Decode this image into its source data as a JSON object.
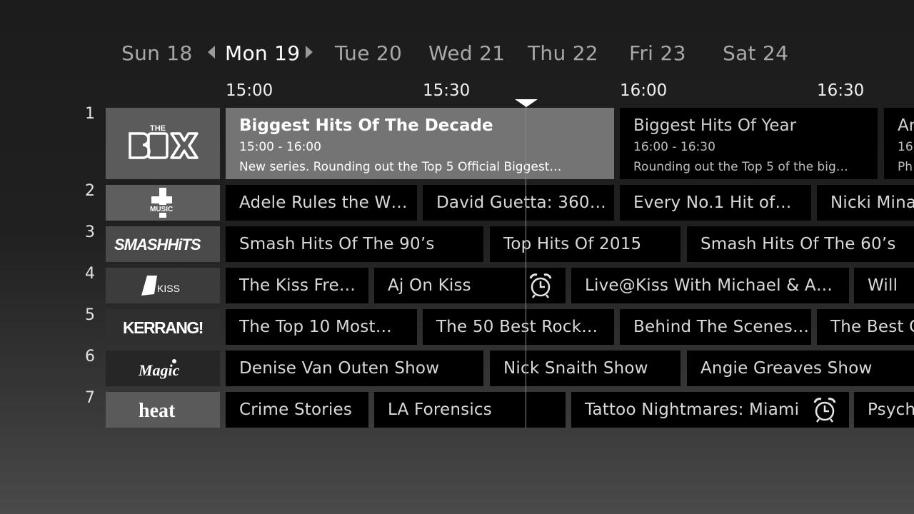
{
  "days": [
    {
      "label": "Sun 18"
    },
    {
      "label": "Mon 19"
    },
    {
      "label": "Tue 20"
    },
    {
      "label": "Wed 21"
    },
    {
      "label": "Thu 22"
    },
    {
      "label": "Fri 23"
    },
    {
      "label": "Sat 24"
    }
  ],
  "selected_day": "Mon 19",
  "times": [
    "15:00",
    "15:30",
    "16:00",
    "16:30"
  ],
  "channels": [
    {
      "number": "1",
      "logo_alt": "THE BOX"
    },
    {
      "number": "2",
      "logo_alt": "4 music"
    },
    {
      "number": "3",
      "logo_alt": "SMASHHITS"
    },
    {
      "number": "4",
      "logo_alt": "KISS"
    },
    {
      "number": "5",
      "logo_alt": "KERRANG!"
    },
    {
      "number": "6",
      "logo_alt": "Magic"
    },
    {
      "number": "7",
      "logo_alt": "heat"
    }
  ],
  "row1": {
    "focused": {
      "title": "Biggest Hits Of The Decade",
      "time": "15:00 - 16:00",
      "desc": "New series. Rounding out the Top 5 Official Biggest…"
    },
    "next": {
      "title": "Biggest Hits Of Year",
      "time": "16:00 - 16:30",
      "desc": "Rounding out the Top 5 of the big…"
    },
    "cut": {
      "title": "Ar",
      "time": "16:",
      "desc": "Ph"
    }
  },
  "row2": [
    "Adele Rules the W…",
    "David Guetta: 360…",
    "Every No.1 Hit of…",
    "Nicki Mina"
  ],
  "row3": [
    "Smash Hits Of The 90’s",
    "Top Hits Of 2015",
    "Smash Hits Of The 60’s"
  ],
  "row4": [
    "The Kiss Fre…",
    "Aj On Kiss",
    "Live@Kiss With Michael & A…",
    "Will"
  ],
  "row5": [
    "The Top 10 Most…",
    "The 50 Best Rock…",
    "Behind The Scenes…",
    "The Best O"
  ],
  "row6": [
    "Denise Van Outen Show",
    "Nick Snaith Show",
    "Angie Greaves Show"
  ],
  "row7": [
    "Crime Stories",
    "LA Forensics",
    "Tattoo Nightmares: Miami",
    "Psych"
  ],
  "icons": {
    "reminder": "alarm-clock-icon",
    "prev": "chevron-left-icon",
    "next": "chevron-right-icon",
    "now": "now-marker-icon"
  },
  "colors": {
    "focused_cell": "#747474",
    "cell": "#000000",
    "logo_light": "#5e5e5e",
    "logo_dark": "#2a2a2a"
  }
}
